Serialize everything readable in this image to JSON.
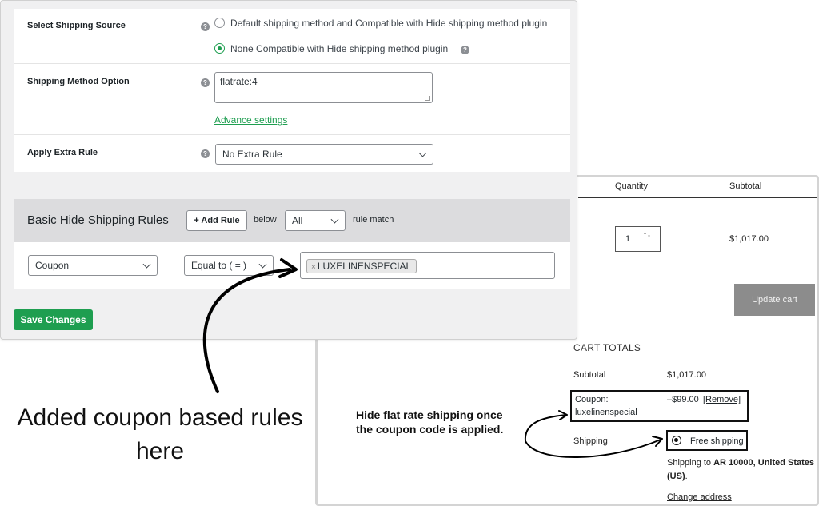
{
  "admin": {
    "shipping_source": {
      "label": "Select Shipping Source",
      "options": [
        {
          "label": "Default shipping method and Compatible with Hide shipping method plugin",
          "selected": false
        },
        {
          "label": "None Compatible with Hide shipping method plugin",
          "selected": true
        }
      ]
    },
    "shipping_method": {
      "label": "Shipping Method Option",
      "value": "flatrate:4",
      "advance_link": "Advance settings"
    },
    "extra_rule": {
      "label": "Apply Extra Rule",
      "value": "No Extra Rule"
    },
    "rules": {
      "title": "Basic Hide Shipping Rules",
      "add_rule_label": "+ Add Rule",
      "below_label": "below",
      "match_value": "All",
      "match_suffix": "rule match",
      "condition": "Coupon",
      "operator": "Equal to ( = )",
      "tag_remove": "×",
      "tag_value": "LUXELINENSPECIAL"
    },
    "save_label": "Save Changes"
  },
  "cart": {
    "col_quantity": "Quantity",
    "col_subtotal": "Subtotal",
    "qty_value": "1",
    "qty_spin": "⌃⌄",
    "line_subtotal": "$1,017.00",
    "update_label": "Update cart",
    "totals_title": "CART TOTALS",
    "subtotal_label": "Subtotal",
    "subtotal_value": "$1,017.00",
    "coupon_label": "Coupon:",
    "coupon_code": "luxelinenspecial",
    "coupon_amount": "–$99.00",
    "coupon_remove": "[Remove]",
    "shipping_label": "Shipping",
    "free_shipping": "Free shipping",
    "ship_to_prefix": "Shipping to ",
    "ship_to_address": "AR 10000, United States (US)",
    "ship_to_suffix": ".",
    "change_address": "Change address"
  },
  "annotations": {
    "hide_note": "Hide flat rate shipping once the coupon code is applied.",
    "caption": "Added coupon based rules here"
  },
  "colors": {
    "accent_green": "#1e9e50",
    "update_button": "#8c8c8c",
    "panel_gray": "#f0f0f1"
  },
  "icons": {
    "help": "question-circle",
    "select": "chevron-down",
    "arrow": "curved-arrow"
  }
}
